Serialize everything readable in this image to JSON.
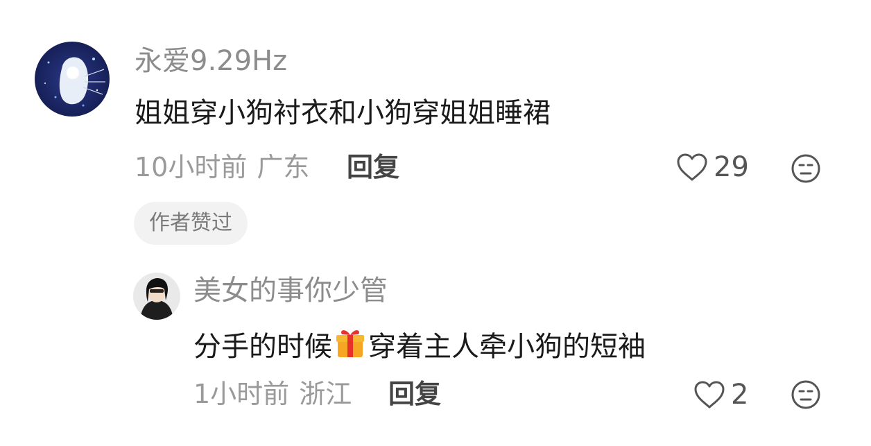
{
  "comment": {
    "username": "永爱9.29Hz",
    "text": "姐姐穿小狗衬衣和小狗穿姐姐睡裙",
    "time": "10小时前",
    "location": "广东",
    "reply_label": "回复",
    "like_count": "29",
    "author_liked_badge": "作者赞过",
    "avatar_icon": "night-sky-girl-avatar",
    "avatar_bg": "#1c2a6b"
  },
  "reply": {
    "username": "美女的事你少管",
    "text_before": "分手的时候",
    "emoji": "🎁",
    "text_after": "穿着主人牵小狗的短袖",
    "time": "1小时前",
    "location": "浙江",
    "reply_label": "回复",
    "like_count": "2",
    "avatar_icon": "portrait-photo-avatar"
  },
  "icons": {
    "like": "heart-outline-icon",
    "emoji": "emoji-face-icon",
    "gift": "gift-emoji-icon"
  },
  "colors": {
    "username": "#8c8c8c",
    "text": "#1a1a1a",
    "meta": "#9a9a9a",
    "badge_bg": "#f2f2f2"
  }
}
